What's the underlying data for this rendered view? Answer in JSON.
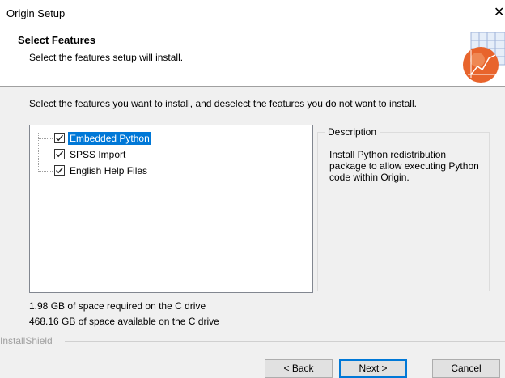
{
  "window": {
    "title": "Origin Setup",
    "close_glyph": "✕"
  },
  "header": {
    "title": "Select Features",
    "subtitle": "Select the features setup will install."
  },
  "instruction": "Select the features you want to install, and deselect the features you do not want to install.",
  "features": [
    {
      "label": "Embedded Python",
      "checked": true,
      "selected": true
    },
    {
      "label": "SPSS Import",
      "checked": true,
      "selected": false
    },
    {
      "label": "English Help Files",
      "checked": true,
      "selected": false
    }
  ],
  "description": {
    "legend": "Description",
    "text": "Install Python redistribution package to allow executing Python code within Origin."
  },
  "space": {
    "required": "1.98 GB of space required on the C drive",
    "available": "468.16 GB of space available on the C drive"
  },
  "footer": {
    "brand": "InstallShield",
    "back_label": "< Back",
    "next_label": "Next >",
    "cancel_label": "Cancel"
  },
  "colors": {
    "selection": "#0078d7",
    "logo_orange": "#e8642c",
    "logo_grid": "#9fb3d9"
  }
}
